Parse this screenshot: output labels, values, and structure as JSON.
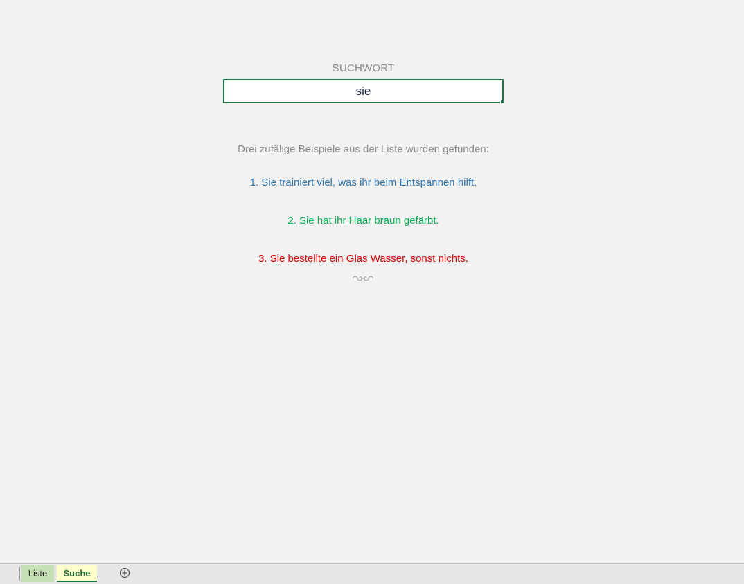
{
  "search": {
    "label": "SUCHWORT",
    "value": "sie"
  },
  "results": {
    "intro": "Drei zufälige Beispiele aus der Liste wurden gefunden:",
    "items": [
      {
        "text": "1. Sie trainiert viel, was ihr beim Entspannen hilft.",
        "color": "#2e75b6"
      },
      {
        "text": "2. Sie hat ihr Haar braun gefärbt.",
        "color": "#00b050"
      },
      {
        "text": "3. Sie bestellte ein Glas Wasser, sonst nichts.",
        "color": "#e00000"
      }
    ],
    "ornament": "ꕥ"
  },
  "tabs": {
    "items": [
      {
        "label": "Liste",
        "color": "#c6e0b4",
        "active": false
      },
      {
        "label": "Suche",
        "color": "#ffffcc",
        "active": true
      }
    ],
    "add_icon": "plus-circle-icon"
  }
}
